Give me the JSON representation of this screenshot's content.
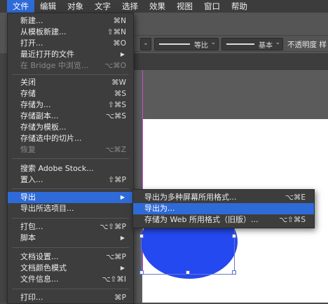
{
  "menubar": {
    "items": [
      "文件",
      "编辑",
      "对象",
      "文字",
      "选择",
      "效果",
      "视图",
      "窗口",
      "帮助"
    ]
  },
  "control_bar": {
    "stroke_profile_label": "等比",
    "brush_label": "基本",
    "opacity_label": "不透明度 样"
  },
  "file_menu": {
    "items": [
      {
        "label": "新建...",
        "shortcut": "⌘N"
      },
      {
        "label": "从模板新建...",
        "shortcut": "⇧⌘N"
      },
      {
        "label": "打开...",
        "shortcut": "⌘O"
      },
      {
        "label": "最近打开的文件",
        "shortcut": ""
      },
      {
        "label": "在 Bridge 中浏览...",
        "shortcut": "⌥⌘O"
      },
      {
        "label": "关闭",
        "shortcut": "⌘W"
      },
      {
        "label": "存储",
        "shortcut": "⌘S"
      },
      {
        "label": "存储为...",
        "shortcut": "⇧⌘S"
      },
      {
        "label": "存储副本...",
        "shortcut": "⌥⌘S"
      },
      {
        "label": "存储为模板...",
        "shortcut": ""
      },
      {
        "label": "存储选中的切片...",
        "shortcut": ""
      },
      {
        "label": "恢复",
        "shortcut": "⌥⌘Z"
      },
      {
        "label": "搜索 Adobe Stock...",
        "shortcut": ""
      },
      {
        "label": "置入...",
        "shortcut": "⇧⌘P"
      },
      {
        "label": "导出",
        "shortcut": ""
      },
      {
        "label": "导出所选项目...",
        "shortcut": ""
      },
      {
        "label": "打包...",
        "shortcut": "⌥⇧⌘P"
      },
      {
        "label": "脚本",
        "shortcut": ""
      },
      {
        "label": "文档设置...",
        "shortcut": "⌥⌘P"
      },
      {
        "label": "文档颜色模式",
        "shortcut": ""
      },
      {
        "label": "文件信息...",
        "shortcut": "⌥⇧⌘I"
      },
      {
        "label": "打印...",
        "shortcut": "⌘P"
      }
    ]
  },
  "export_submenu": {
    "items": [
      {
        "label": "导出为多种屏幕所用格式...",
        "shortcut": "⌥⌘E"
      },
      {
        "label": "导出为...",
        "shortcut": ""
      },
      {
        "label": "存储为 Web 所用格式（旧版）...",
        "shortcut": "⌥⇧⌘S"
      }
    ]
  },
  "icons": {
    "submenu_arrow": "triangle-right-icon",
    "dropdown": "chevron-down-icon"
  },
  "colors": {
    "highlight": "#2f6bd8",
    "circle_fill": "#2449f0",
    "guide": "#c54fd2"
  }
}
